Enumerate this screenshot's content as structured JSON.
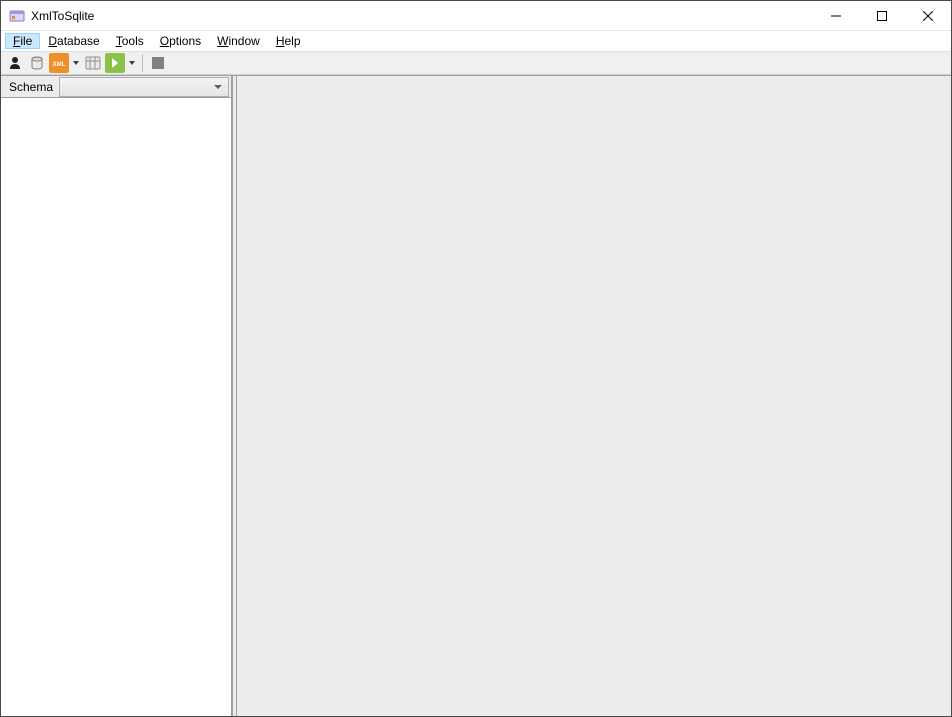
{
  "title": "XmlToSqlite",
  "menu": {
    "file": "File",
    "database": "Database",
    "tools": "Tools",
    "options": "Options",
    "window": "Window",
    "help": "Help"
  },
  "toolbar": {
    "icons": {
      "user": "user-icon",
      "open_db": "open-db-icon",
      "xml": "xml-icon",
      "sql": "sql-icon",
      "export": "export-icon",
      "stop": "stop-icon"
    }
  },
  "sidebar": {
    "schema_label": "Schema",
    "schema_value": ""
  }
}
